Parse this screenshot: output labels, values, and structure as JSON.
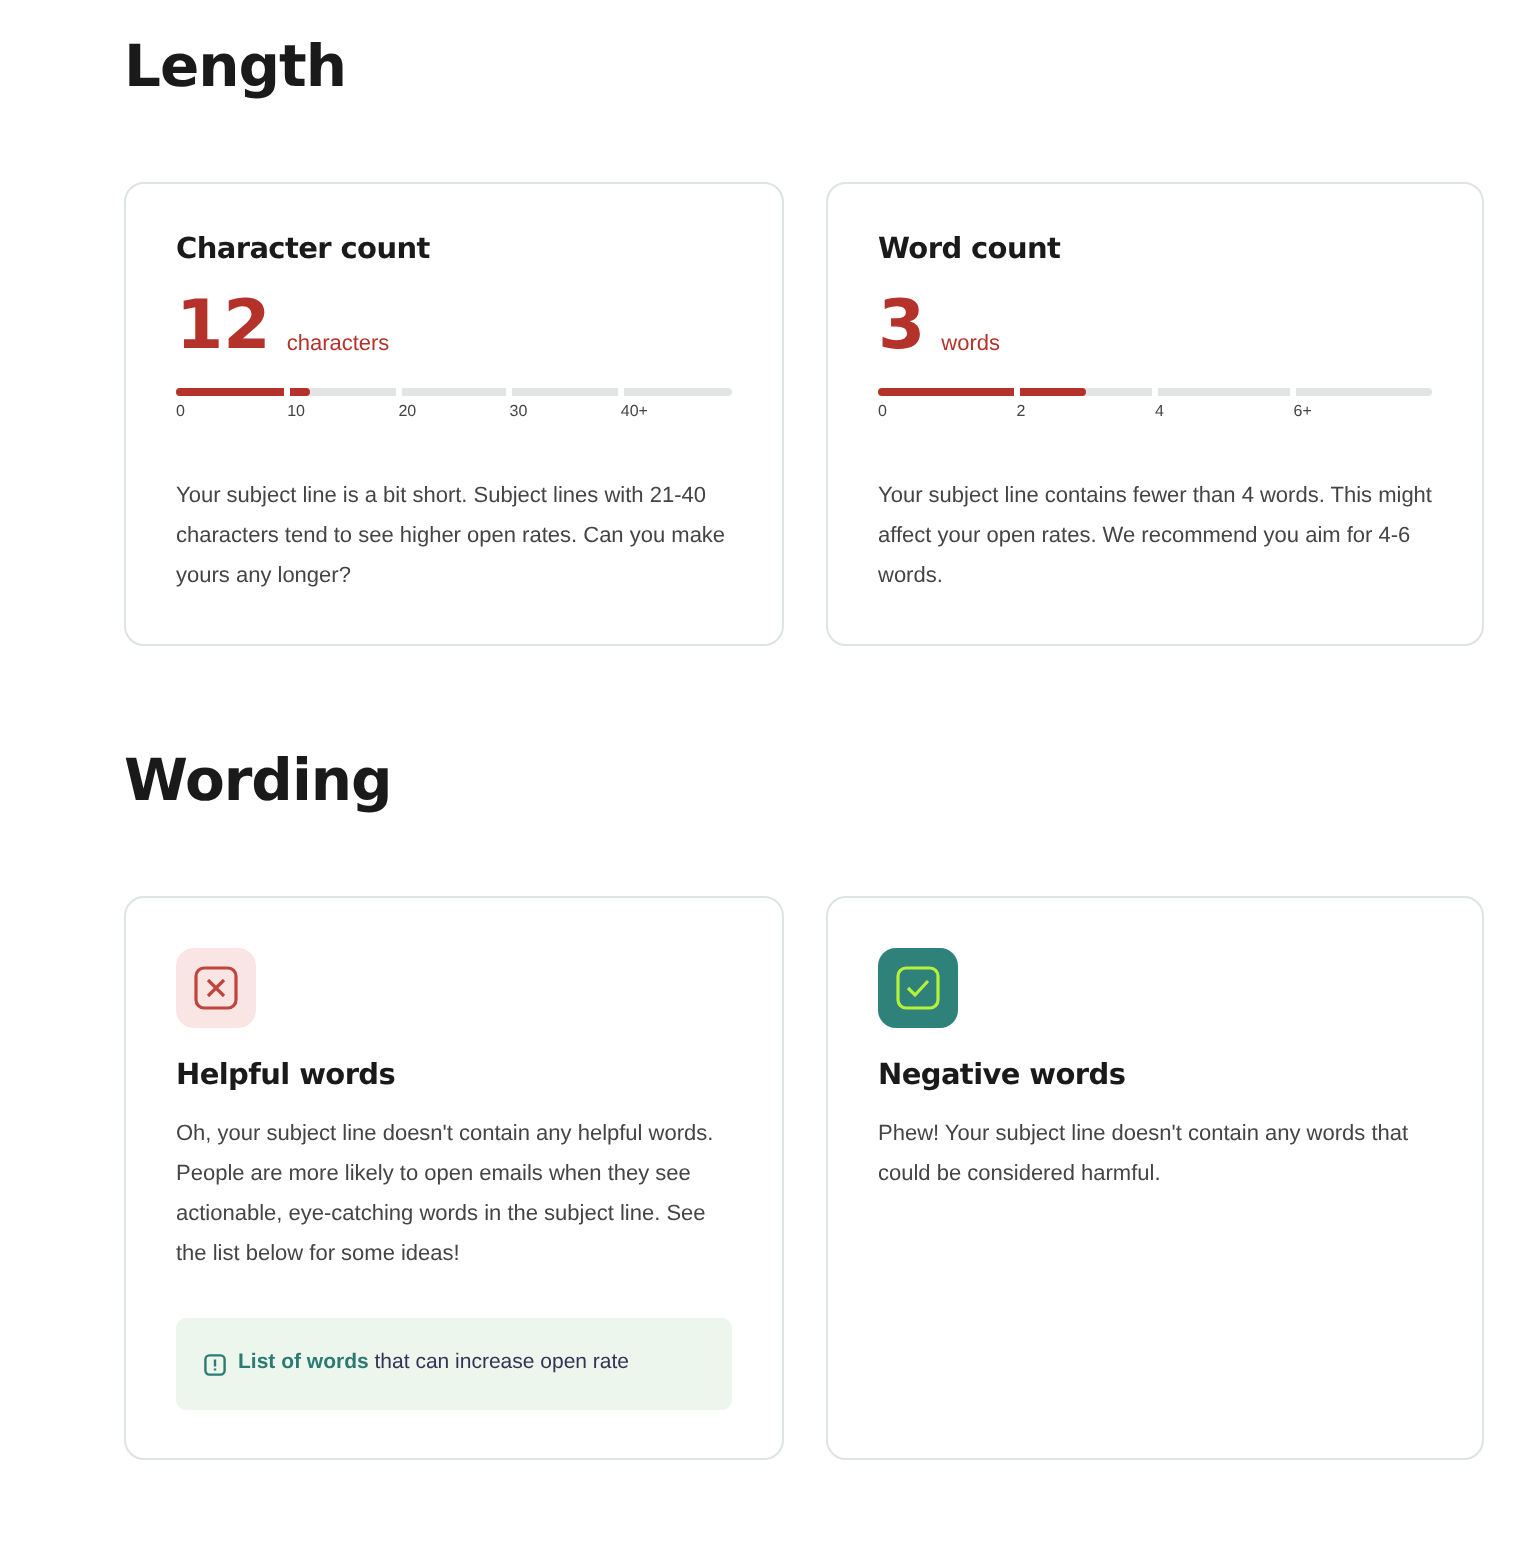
{
  "sections": [
    {
      "title": "Length",
      "kind": "meters",
      "cards": [
        {
          "title": "Character count",
          "value": "12",
          "unit": "characters",
          "level": 0.24,
          "ticks": [
            "0",
            "10",
            "20",
            "30",
            "40+"
          ],
          "text": "Your subject line is a bit short. Subject lines with 21-40 characters tend to see higher open rates. Can you make yours any longer?"
        },
        {
          "title": "Word count",
          "value": "3",
          "unit": "words",
          "level": 0.375,
          "ticks": [
            "0",
            "2",
            "4",
            "6+"
          ],
          "text": "Your subject line contains fewer than 4 words. This might affect your open rates. We recommend you aim for 4-6 words."
        }
      ]
    },
    {
      "title": "Wording",
      "kind": "checks",
      "cards": [
        {
          "title": "Helpful words",
          "kind": "cross",
          "text": "Oh, your subject line doesn't contain any helpful words. People are more likely to open emails when they see actionable, eye-catching words in the subject line. See the list below for some ideas!",
          "callout": {
            "link": "List of words",
            "text": "that can increase open rate"
          }
        },
        {
          "title": "Negative words",
          "kind": "check",
          "text": "Phew! Your subject line doesn't contain any words that could be considered harmful."
        }
      ]
    }
  ]
}
